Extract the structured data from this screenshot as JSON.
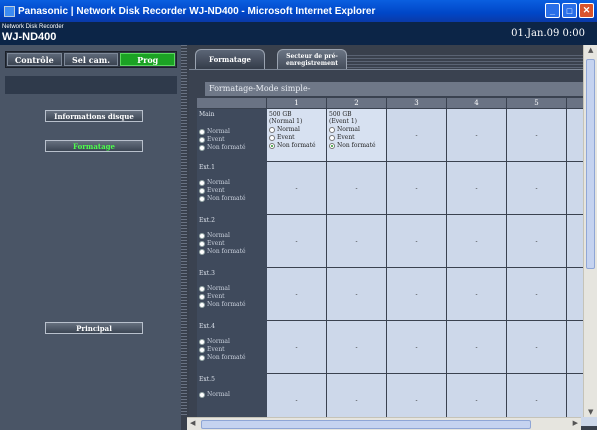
{
  "window": {
    "title": "Panasonic | Network Disk Recorder WJ-ND400 - Microsoft Internet Explorer",
    "controls": [
      "_",
      "□",
      "✕"
    ]
  },
  "header": {
    "subtitle": "Network Disk Recorder",
    "model": "WJ-ND400",
    "datetime": "01.Jan.09  0:00"
  },
  "modes": [
    {
      "label": "Contrôle"
    },
    {
      "label": "Sel cam."
    },
    {
      "label": "Prog",
      "active": true
    }
  ],
  "left_buttons": {
    "info": "Informations disque",
    "format": "Formatage",
    "principal": "Principal"
  },
  "tabs": [
    {
      "label": "Formatage",
      "active": true
    },
    {
      "label": "Secteur de pré-enregistrement",
      "active": false
    }
  ],
  "panel_title": "Formatage-Mode simple-",
  "columns": [
    "1",
    "2",
    "3",
    "4",
    "5",
    ""
  ],
  "rows": [
    {
      "label": "Main",
      "options": [
        "Normal",
        "Event",
        "Non formaté"
      ],
      "selected": 2,
      "cells": [
        {
          "size": "500 GB",
          "mode": "(Normal 1)",
          "selected": 2
        },
        {
          "size": "500 GB",
          "mode": "(Event 1)",
          "selected": 2
        },
        "-",
        "-",
        "-",
        ""
      ]
    },
    {
      "label": "Ext.1",
      "options": [
        "Normal",
        "Event",
        "Non formaté"
      ],
      "selected": 2,
      "cells": [
        "-",
        "-",
        "-",
        "-",
        "-",
        ""
      ]
    },
    {
      "label": "Ext.2",
      "options": [
        "Normal",
        "Event",
        "Non formaté"
      ],
      "selected": 2,
      "cells": [
        "-",
        "-",
        "-",
        "-",
        "-",
        ""
      ]
    },
    {
      "label": "Ext.3",
      "options": [
        "Normal",
        "Event",
        "Non formaté"
      ],
      "selected": 2,
      "cells": [
        "-",
        "-",
        "-",
        "-",
        "-",
        ""
      ]
    },
    {
      "label": "Ext.4",
      "options": [
        "Normal",
        "Event",
        "Non formaté"
      ],
      "selected": 2,
      "cells": [
        "-",
        "-",
        "-",
        "-",
        "-",
        ""
      ]
    },
    {
      "label": "Ext.5",
      "options": [
        "Normal"
      ],
      "selected": -1,
      "cells": [
        "-",
        "-",
        "-",
        "-",
        "-",
        ""
      ]
    }
  ],
  "cell_options": [
    "Normal",
    "Event",
    "Non formaté"
  ]
}
